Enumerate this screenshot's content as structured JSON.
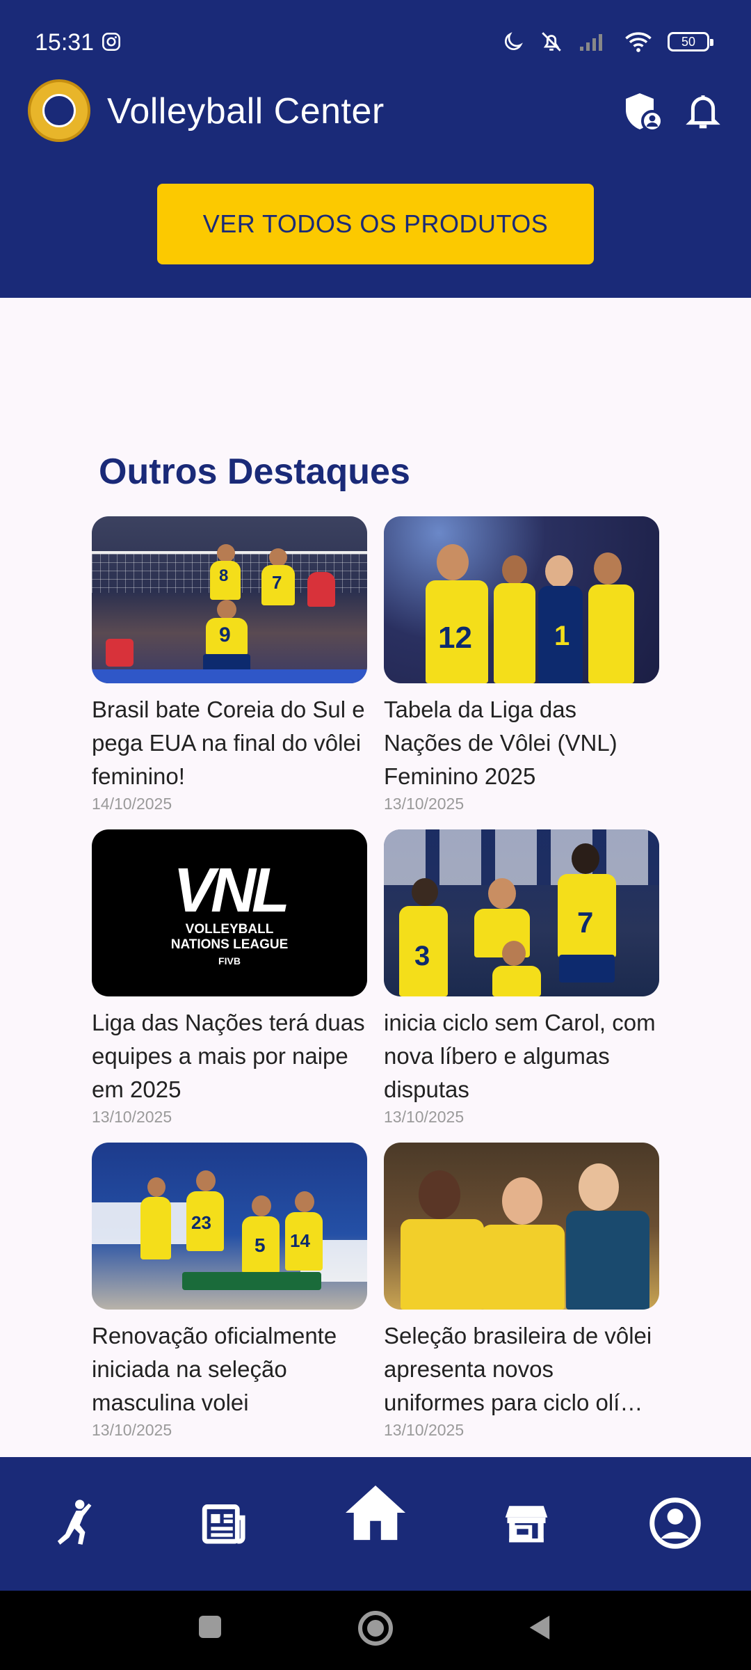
{
  "status_bar": {
    "time": "15:31",
    "battery": "50",
    "icons": [
      "instagram-icon",
      "moon-icon",
      "bell-off-icon",
      "signal-icon",
      "wifi-icon",
      "battery-icon"
    ]
  },
  "app_bar": {
    "title": "Volleyball Center",
    "icons": [
      "app-logo",
      "shield-user-icon",
      "bell-icon"
    ]
  },
  "banner": {
    "cta_label": "VER TODOS OS PRODUTOS"
  },
  "section": {
    "title": "Outros Destaques",
    "cards": [
      {
        "title": "Brasil bate Coreia do Sul e pega EUA na final do vôlei feminino!",
        "date": "14/10/2025"
      },
      {
        "title": "Tabela da Liga das Nações de Vôlei (VNL) Feminino 2025",
        "date": "13/10/2025"
      },
      {
        "title": "Liga das Nações terá duas equipes a mais por naipe em 2025",
        "date": "13/10/2025"
      },
      {
        "title": "inicia ciclo sem Carol, com nova líbero e algumas disputas",
        "date": "13/10/2025"
      },
      {
        "title": "Renovação oficialmente iniciada na seleção masculina volei",
        "date": "13/10/2025"
      },
      {
        "title": "Seleção brasileira de vôlei apresenta novos uniformes para ciclo olí…",
        "date": "13/10/2025"
      }
    ],
    "image_text": {
      "vnl_big": "VNL",
      "vnl_line1": "VOLLEYBALL",
      "vnl_line2": "NATIONS LEAGUE",
      "vnl_fivb": "FIVB"
    }
  },
  "bottom_nav": {
    "items": [
      "volleyball-player-icon",
      "news-icon",
      "home-icon",
      "store-icon",
      "profile-icon"
    ],
    "active": "home-icon"
  },
  "colors": {
    "primary": "#1a2a78",
    "accent": "#fcc900",
    "background": "#fcf7fc"
  }
}
